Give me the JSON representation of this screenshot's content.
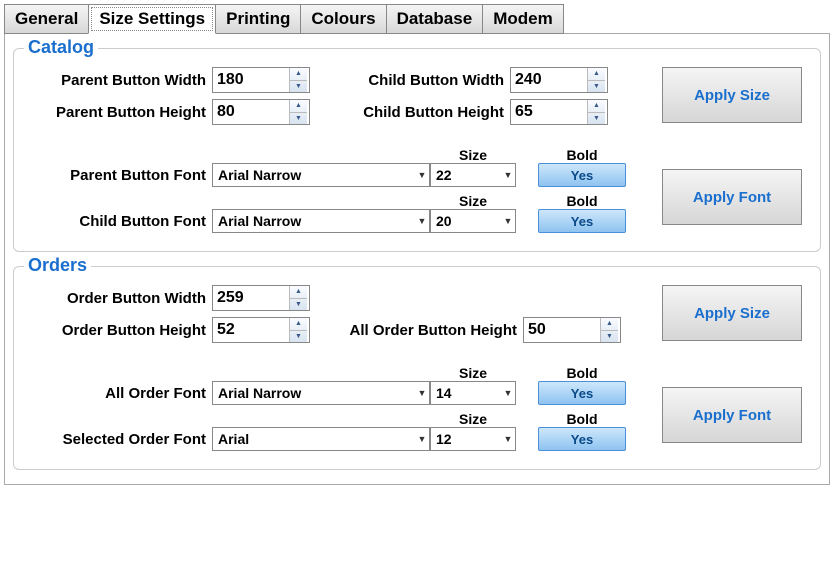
{
  "tabs": {
    "general": "General",
    "size_settings": "Size Settings",
    "printing": "Printing",
    "colours": "Colours",
    "database": "Database",
    "modem": "Modem"
  },
  "catalog": {
    "title": "Catalog",
    "parent_width_label": "Parent Button Width",
    "parent_width": "180",
    "parent_height_label": "Parent Button Height",
    "parent_height": "80",
    "child_width_label": "Child Button Width",
    "child_width": "240",
    "child_height_label": "Child Button Height",
    "child_height": "65",
    "apply_size": "Apply Size",
    "size_header": "Size",
    "bold_header": "Bold",
    "parent_font_label": "Parent Button Font",
    "parent_font": "Arial Narrow",
    "parent_font_size": "22",
    "parent_font_bold": "Yes",
    "child_font_label": "Child Button Font",
    "child_font": "Arial Narrow",
    "child_font_size": "20",
    "child_font_bold": "Yes",
    "apply_font": "Apply Font"
  },
  "orders": {
    "title": "Orders",
    "width_label": "Order Button Width",
    "width": "259",
    "height_label": "Order Button Height",
    "height": "52",
    "all_height_label": "All Order Button Height",
    "all_height": "50",
    "apply_size": "Apply Size",
    "size_header": "Size",
    "bold_header": "Bold",
    "all_font_label": "All Order Font",
    "all_font": "Arial Narrow",
    "all_font_size": "14",
    "all_font_bold": "Yes",
    "selected_font_label": "Selected Order Font",
    "selected_font": "Arial",
    "selected_font_size": "12",
    "selected_font_bold": "Yes",
    "apply_font": "Apply Font"
  }
}
